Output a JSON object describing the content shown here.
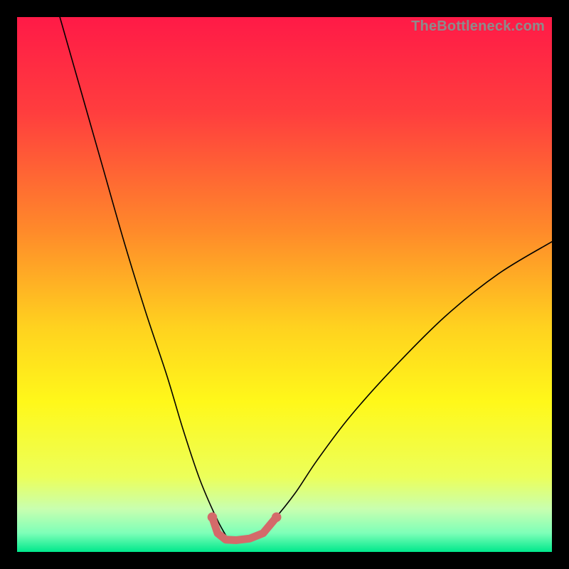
{
  "watermark": "TheBottleneck.com",
  "colors": {
    "frame": "#000000",
    "gradient_stops": [
      {
        "pos": 0.0,
        "color": "#ff1a47"
      },
      {
        "pos": 0.18,
        "color": "#ff3e3e"
      },
      {
        "pos": 0.4,
        "color": "#ff8a2a"
      },
      {
        "pos": 0.58,
        "color": "#ffd21f"
      },
      {
        "pos": 0.72,
        "color": "#fff81a"
      },
      {
        "pos": 0.86,
        "color": "#ecff5a"
      },
      {
        "pos": 0.92,
        "color": "#c8ffb0"
      },
      {
        "pos": 0.965,
        "color": "#7dffb8"
      },
      {
        "pos": 1.0,
        "color": "#00e88c"
      }
    ],
    "curve_stroke": "#000000",
    "trough_stroke": "#d46a6a"
  },
  "chart_data": {
    "type": "line",
    "title": "",
    "xlabel": "",
    "ylabel": "",
    "xlim": [
      0,
      100
    ],
    "ylim": [
      0,
      100
    ],
    "series": [
      {
        "name": "bottleneck-curve",
        "x": [
          8,
          12,
          16,
          20,
          24,
          28,
          31,
          34,
          36.5,
          38.5,
          40,
          42,
          45,
          48,
          52,
          56,
          62,
          70,
          80,
          90,
          100
        ],
        "y": [
          100,
          86,
          72,
          58,
          45,
          33,
          23,
          14,
          8,
          4,
          2,
          2,
          3,
          6,
          11,
          17,
          25,
          34,
          44,
          52,
          58
        ]
      }
    ],
    "annotations": [
      {
        "name": "trough-marker",
        "type": "polyline",
        "x": [
          36.5,
          37.5,
          39,
          41,
          43.5,
          46,
          48.5
        ],
        "y": [
          6.5,
          3.5,
          2.3,
          2.2,
          2.5,
          3.5,
          6.5
        ]
      }
    ]
  }
}
